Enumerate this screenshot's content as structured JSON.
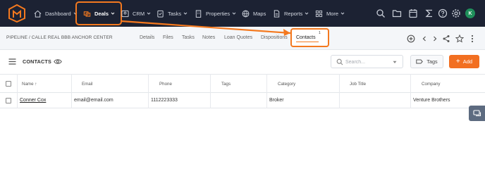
{
  "nav": {
    "items": [
      {
        "label": "Dashboard",
        "icon": "home-icon"
      },
      {
        "label": "Deals",
        "icon": "deals-icon",
        "active": true
      },
      {
        "label": "CRM",
        "icon": "crm-icon"
      },
      {
        "label": "Tasks",
        "icon": "tasks-icon"
      },
      {
        "label": "Properties",
        "icon": "building-icon"
      },
      {
        "label": "Maps",
        "icon": "globe-icon"
      },
      {
        "label": "Reports",
        "icon": "report-icon"
      },
      {
        "label": "More",
        "icon": "grid-icon"
      }
    ],
    "avatar_initial": "K",
    "highlight_color": "#f4791f"
  },
  "subbar": {
    "breadcrumb": "PIPELINE / CALLE REAL BBB ANCHOR CENTER",
    "tabs": [
      "Details",
      "Files",
      "Tasks",
      "Notes",
      "Loan Quotes",
      "Dispositions",
      "Contacts"
    ],
    "active_tab": "Contacts",
    "active_count": "1"
  },
  "toolbar": {
    "title": "CONTACTS",
    "search_placeholder": "Search...",
    "tags_label": "Tags",
    "add_label": "Add",
    "add_color": "#f26f21"
  },
  "table": {
    "columns": [
      "Name",
      "Email",
      "Phone",
      "Tags",
      "Category",
      "Job Title",
      "Company"
    ],
    "rows": [
      {
        "name": "Conner Cox",
        "email": "email@email.com",
        "phone": "1112223333",
        "tags": "",
        "category": "Broker",
        "job_title": "",
        "company": "Venture Brothers"
      }
    ]
  }
}
